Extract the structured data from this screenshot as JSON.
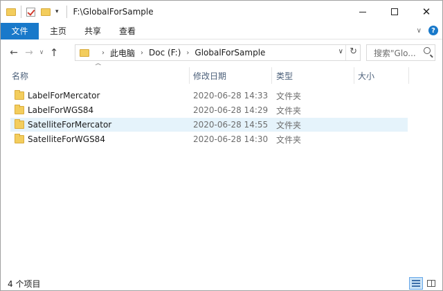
{
  "window": {
    "title": "F:\\GlobalForSample",
    "controls": {
      "minimize": "minimize",
      "maximize": "maximize",
      "close": "✕"
    }
  },
  "ribbon": {
    "tabs": [
      {
        "label": "文件"
      },
      {
        "label": "主页"
      },
      {
        "label": "共享"
      },
      {
        "label": "查看"
      }
    ]
  },
  "address": {
    "crumbs": [
      "此电脑",
      "Doc (F:)",
      "GlobalForSample"
    ]
  },
  "search": {
    "placeholder": "搜索\"Glo..."
  },
  "columns": {
    "name": "名称",
    "date": "修改日期",
    "type": "类型",
    "size": "大小"
  },
  "files": [
    {
      "name": "LabelForMercator",
      "date": "2020-06-28 14:33",
      "type": "文件夹",
      "selected": false
    },
    {
      "name": "LabelForWGS84",
      "date": "2020-06-28 14:29",
      "type": "文件夹",
      "selected": false
    },
    {
      "name": "SatelliteForMercator",
      "date": "2020-06-28 14:55",
      "type": "文件夹",
      "selected": true
    },
    {
      "name": "SatelliteForWGS84",
      "date": "2020-06-28 14:30",
      "type": "文件夹",
      "selected": false
    }
  ],
  "status": {
    "count": "4 个项目"
  },
  "icons": {
    "folder": "folder-icon",
    "back": "arrow-left-icon",
    "forward": "arrow-right-icon",
    "up": "arrow-up-icon",
    "refresh": "refresh-icon",
    "search": "search-icon"
  },
  "colors": {
    "accent": "#1979ca",
    "selection": "#e5f3fb",
    "folder": "#f3cd5d",
    "header_text": "#4c607a"
  }
}
